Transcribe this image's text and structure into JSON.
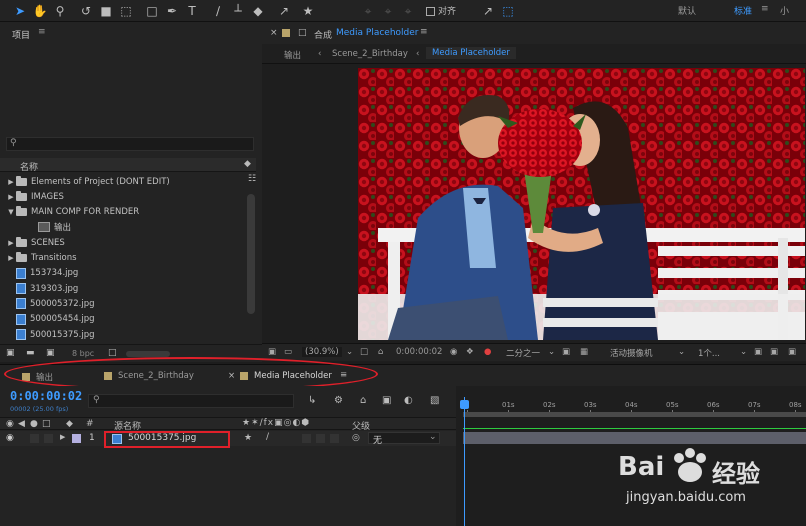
{
  "toolbar": {
    "snap_label": "对齐",
    "workspaces": [
      {
        "label": "默认",
        "active": false
      },
      {
        "label": "标准",
        "active": true
      },
      {
        "label": "小",
        "active": false
      }
    ],
    "icons": [
      "selection-tool-icon",
      "hand-tool-icon",
      "zoom-tool-icon",
      "rotate-tool-icon",
      "camera-tool-icon",
      "pan-behind-icon",
      "rectangle-tool-icon",
      "pen-tool-icon",
      "type-tool-icon",
      "brush-tool-icon",
      "clone-stamp-icon",
      "eraser-icon",
      "roto-brush-icon",
      "puppet-pin-icon"
    ]
  },
  "project": {
    "title": "项目",
    "search_placeholder": "",
    "column_name": "名称",
    "items": [
      {
        "label": "Elements of Project (DONT EDIT)",
        "kind": "folder",
        "expanded": false,
        "indent": 0
      },
      {
        "label": "IMAGES",
        "kind": "folder",
        "expanded": false,
        "indent": 0
      },
      {
        "label": "MAIN COMP FOR RENDER",
        "kind": "folder",
        "expanded": true,
        "indent": 0
      },
      {
        "label": "输出",
        "kind": "comp",
        "expanded": false,
        "indent": 1
      },
      {
        "label": "SCENES",
        "kind": "folder",
        "expanded": false,
        "indent": 0
      },
      {
        "label": "Transitions",
        "kind": "folder",
        "expanded": false,
        "indent": 0
      },
      {
        "label": "153734.jpg",
        "kind": "file",
        "indent": 0
      },
      {
        "label": "319303.jpg",
        "kind": "file",
        "indent": 0
      },
      {
        "label": "500005372.jpg",
        "kind": "file",
        "indent": 0
      },
      {
        "label": "500005454.jpg",
        "kind": "file",
        "indent": 0
      },
      {
        "label": "500015375.jpg",
        "kind": "file",
        "indent": 0
      }
    ],
    "bpc_label": "8 bpc"
  },
  "viewer": {
    "tab_prefix": "合成",
    "tab_title": "Media Placeholder",
    "breadcrumbs": [
      "输出",
      "Scene_2_Birthday",
      "Media Placeholder"
    ],
    "zoom": "(30.9%)",
    "timecode": "0:00:00:02",
    "resolution": "二分之一",
    "camera": "活动摄像机",
    "views": "1个..."
  },
  "timeline": {
    "tabs": [
      {
        "label": "输出",
        "active": false
      },
      {
        "label": "Scene_2_Birthday",
        "active": false
      },
      {
        "label": "Media Placeholder",
        "active": true
      }
    ],
    "timecode": "0:00:00:02",
    "fps": "00002 (25.00 fps)",
    "column_num": "#",
    "column_source": "源名称",
    "column_parent": "父级",
    "ruler_ticks": [
      "0s",
      "01s",
      "02s",
      "03s",
      "04s",
      "05s",
      "06s",
      "07s",
      "08s"
    ],
    "layer": {
      "index": "1",
      "name": "500015375.jpg",
      "parent": "无"
    }
  },
  "watermark": {
    "logo_text": "Bai",
    "logo_text2": "经验",
    "url": "jingyan.baidu.com"
  },
  "colors": {
    "accent": "#3e9bff",
    "highlight_red": "#e0202a",
    "layer_label": "#b4b0e0"
  }
}
